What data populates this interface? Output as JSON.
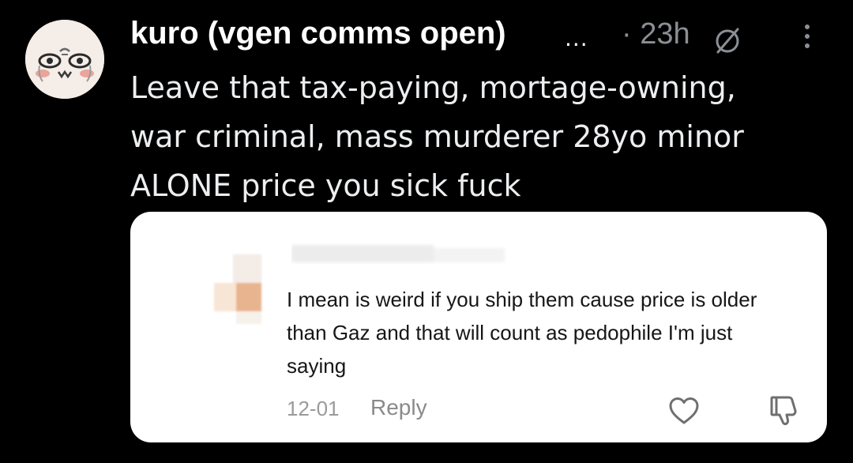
{
  "post": {
    "author_name": "kuro (vgen comms open)",
    "truncation": "...",
    "time": "· 23h",
    "text_lines": [
      "Leave that tax-paying, mortage-owning,",
      "war criminal, mass murderer 28yo minor",
      "ALONE price you sick fuck"
    ]
  },
  "quoted_comment": {
    "text_lines": [
      "I mean is weird if you ship them cause price is older",
      "than Gaz and that will count as pedophile I'm just",
      "saying"
    ],
    "date": "12-01",
    "reply_label": "Reply"
  },
  "icons": {
    "avatar": "sticker-avatar",
    "status": "null-circle-icon",
    "more": "more-vertical-icon",
    "like": "heart-icon",
    "dislike": "thumbs-down-icon"
  },
  "colors": {
    "background": "#000000",
    "text_primary": "#e7e9ea",
    "text_secondary": "#8b8f94",
    "card_background": "#ffffff",
    "card_text": "#161616",
    "card_muted": "#9a9a9a"
  }
}
